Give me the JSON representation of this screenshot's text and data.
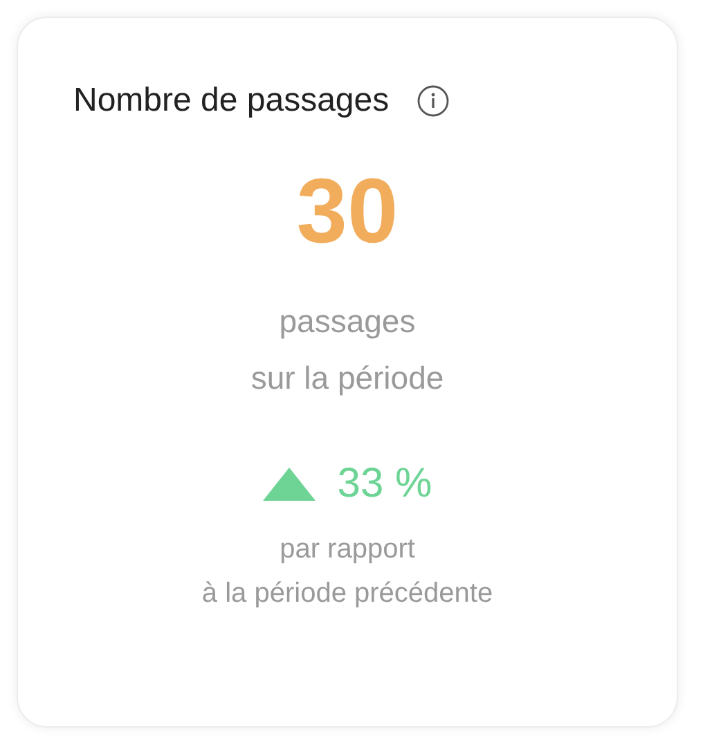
{
  "card": {
    "title": "Nombre de passages",
    "value": "30",
    "value_caption": [
      "passages",
      "sur la période"
    ],
    "change": {
      "kind": "increase",
      "text": "33 %"
    },
    "comparison": [
      "par rapport",
      "à la période précédente"
    ]
  }
}
